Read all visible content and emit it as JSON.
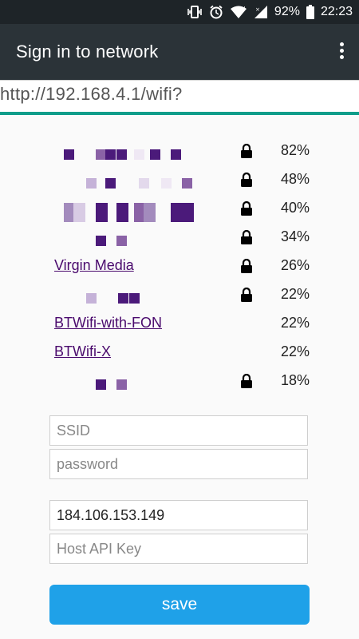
{
  "status_bar": {
    "battery": "92%",
    "time": "22:23",
    "icons": [
      "vibrate-icon",
      "alarm-icon",
      "wifi-icon",
      "signal-icon",
      "battery-icon"
    ]
  },
  "app_bar": {
    "title": "Sign in to network",
    "menu_icon": "overflow-menu-icon"
  },
  "url_bar": {
    "url": "http://192.168.4.1/wifi?"
  },
  "networks": [
    {
      "name": "",
      "locked": true,
      "signal": "82%"
    },
    {
      "name": "",
      "locked": true,
      "signal": "48%"
    },
    {
      "name": "",
      "locked": true,
      "signal": "40%"
    },
    {
      "name": "",
      "locked": true,
      "signal": "34%"
    },
    {
      "name": "Virgin Media",
      "locked": true,
      "signal": "26%"
    },
    {
      "name": "",
      "locked": true,
      "signal": "22%"
    },
    {
      "name": "BTWifi-with-FON",
      "locked": false,
      "signal": "22%"
    },
    {
      "name": "BTWifi-X",
      "locked": false,
      "signal": "22%"
    },
    {
      "name": "",
      "locked": true,
      "signal": "18%"
    }
  ],
  "form": {
    "ssid": {
      "value": "",
      "placeholder": "SSID"
    },
    "password": {
      "value": "",
      "placeholder": "password"
    },
    "host": {
      "value": "184.106.153.149",
      "placeholder": ""
    },
    "api_key": {
      "value": "",
      "placeholder": "Host API Key"
    },
    "save_label": "save"
  },
  "colors": {
    "accent": "#1fa1e8",
    "progress": "#0f9d8a",
    "link": "#4a0a6d",
    "app_bar": "#2b3338"
  }
}
